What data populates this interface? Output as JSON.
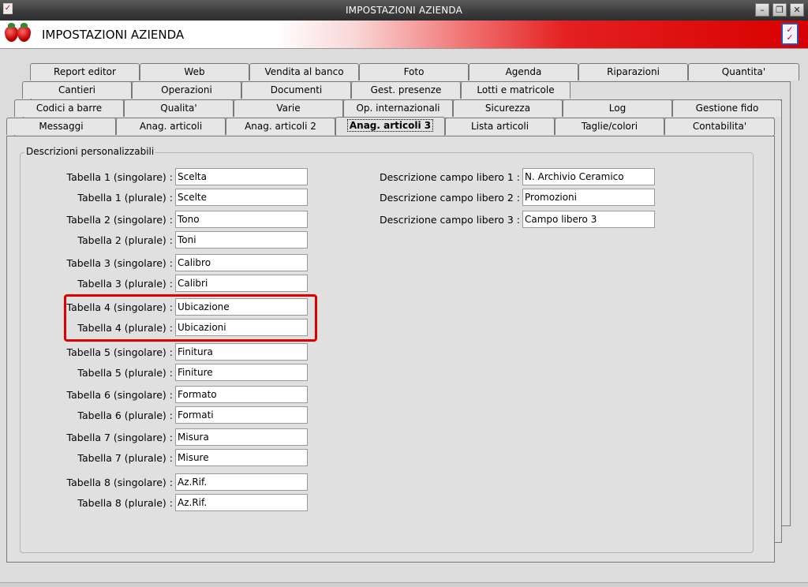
{
  "window": {
    "title": "IMPOSTAZIONI AZIENDA",
    "controls": {
      "minimize": "–",
      "restore": "❐",
      "close": "✕"
    }
  },
  "header": {
    "title": "IMPOSTAZIONI AZIENDA",
    "left_icon": "strawberry-icon",
    "right_icon": "checklist-icon"
  },
  "tabs": {
    "row1": [
      "Report editor",
      "Web",
      "Vendita al banco",
      "Foto",
      "Agenda",
      "Riparazioni",
      "Quantita'"
    ],
    "row2": [
      "Cantieri",
      "Operazioni",
      "Documenti",
      "Gest. presenze",
      "Lotti e matricole"
    ],
    "row3": [
      "Codici a barre",
      "Qualita'",
      "Varie",
      "Op. internazionali",
      "Sicurezza",
      "Log",
      "Gestione fido"
    ],
    "row4": [
      "Messaggi",
      "Anag. articoli",
      "Anag. articoli 2",
      "Anag. articoli 3",
      "Lista articoli",
      "Taglie/colori",
      "Contabilita'"
    ],
    "active": "Anag. articoli 3"
  },
  "group_title": "Descrizioni personalizzabili",
  "tables": [
    {
      "label": "Tabella 1 (singolare) :",
      "value": "Scelta"
    },
    {
      "label": "Tabella 1 (plurale) :",
      "value": "Scelte"
    },
    {
      "label": "Tabella 2 (singolare) :",
      "value": "Tono"
    },
    {
      "label": "Tabella 2 (plurale) :",
      "value": "Toni"
    },
    {
      "label": "Tabella 3 (singolare) :",
      "value": "Calibro"
    },
    {
      "label": "Tabella 3 (plurale) :",
      "value": "Calibri"
    },
    {
      "label": "Tabella 4 (singolare) :",
      "value": "Ubicazione"
    },
    {
      "label": "Tabella 4 (plurale) :",
      "value": "Ubicazioni"
    },
    {
      "label": "Tabella 5 (singolare) :",
      "value": "Finitura"
    },
    {
      "label": "Tabella 5 (plurale) :",
      "value": "Finiture"
    },
    {
      "label": "Tabella 6 (singolare) :",
      "value": "Formato"
    },
    {
      "label": "Tabella 6 (plurale) :",
      "value": "Formati"
    },
    {
      "label": "Tabella 7 (singolare) :",
      "value": "Misura"
    },
    {
      "label": "Tabella 7 (plurale) :",
      "value": "Misure"
    },
    {
      "label": "Tabella 8 (singolare) :",
      "value": "Az.Rif."
    },
    {
      "label": "Tabella 8 (plurale) :",
      "value": "Az.Rif."
    }
  ],
  "free_fields": [
    {
      "label": "Descrizione campo libero 1 :",
      "value": "N. Archivio Ceramico"
    },
    {
      "label": "Descrizione campo libero 2 :",
      "value": "Promozioni"
    },
    {
      "label": "Descrizione campo libero 3 :",
      "value": "Campo libero 3"
    }
  ],
  "colors": {
    "highlight": "#e00000",
    "header_gradient_end": "#d80000"
  }
}
